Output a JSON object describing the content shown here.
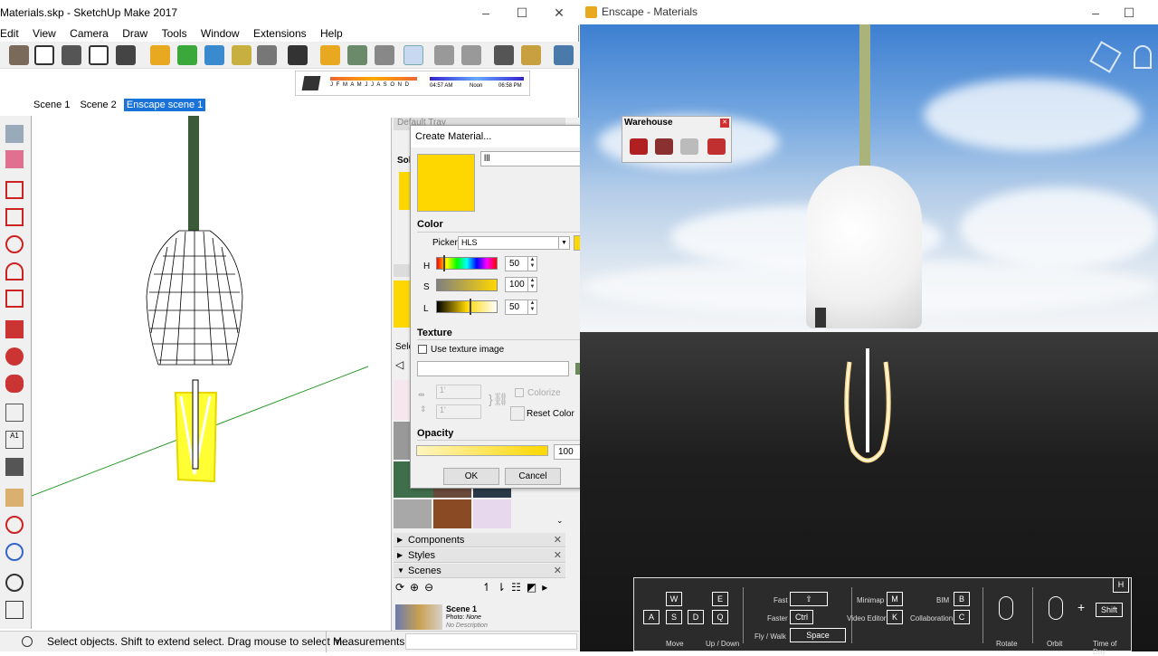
{
  "sketchup": {
    "title": "Materials.skp - SketchUp Make 2017",
    "menu": [
      "Edit",
      "View",
      "Camera",
      "Draw",
      "Tools",
      "Window",
      "Extensions",
      "Help"
    ],
    "shadow_months": "J F M A M J J A S O N D",
    "shadow_time_start": "04:57 AM",
    "shadow_time_mid": "Noon",
    "shadow_time_end": "06:58 PM",
    "scenes": [
      "Scene 1",
      "Scene 2",
      "Enscape scene 1"
    ],
    "active_scene": "Enscape scene 1",
    "status_text": "Select objects. Shift to extend select. Drag mouse to select m...",
    "measurements_label": "Measurements"
  },
  "tray": {
    "default_tray_label": "Default Tray",
    "solid_label": "Sol",
    "select_label": "Sele",
    "sections": [
      "Components",
      "Styles",
      "Scenes"
    ],
    "scene_name": "Scene 1",
    "scene_photo_label": "Photo:",
    "scene_photo_value": "None",
    "scene_desc": "No Description"
  },
  "dialog": {
    "title": "Create Material...",
    "name_value": "lll",
    "color_header": "Color",
    "picker_label": "Picker:",
    "picker_value": "HLS",
    "h_label": "H",
    "h_value": "50",
    "s_label": "S",
    "s_value": "100",
    "l_label": "L",
    "l_value": "50",
    "texture_header": "Texture",
    "use_texture_label": "Use texture image",
    "tex_w": "1'",
    "tex_h": "1'",
    "colorize_label": "Colorize",
    "reset_color_label": "Reset Color",
    "opacity_header": "Opacity",
    "opacity_value": "100",
    "ok_label": "OK",
    "cancel_label": "Cancel",
    "swatch_color": "#ffd700"
  },
  "enscape": {
    "title": "Enscape - Materials",
    "warehouse_title": "Warehouse",
    "help_key": "H",
    "keys": {
      "w": "W",
      "a": "A",
      "s": "S",
      "d": "D",
      "e": "E",
      "q": "Q",
      "move_label": "Move",
      "updown_label": "Up / Down",
      "fast_label": "Fast",
      "faster_label": "Faster",
      "faster_key": "Ctrl",
      "flywalk_label": "Fly / Walk",
      "space_key": "Space",
      "minimap_label": "Minimap",
      "minimap_key": "M",
      "videoeditor_label": "Video Editor",
      "videoeditor_key": "K",
      "bim_label": "BIM",
      "bim_key": "B",
      "collab_label": "Collaboration",
      "collab_key": "C",
      "rotate_label": "Rotate",
      "orbit_label": "Orbit",
      "shift_key": "Shift",
      "timeofday_label": "Time of Day"
    }
  }
}
